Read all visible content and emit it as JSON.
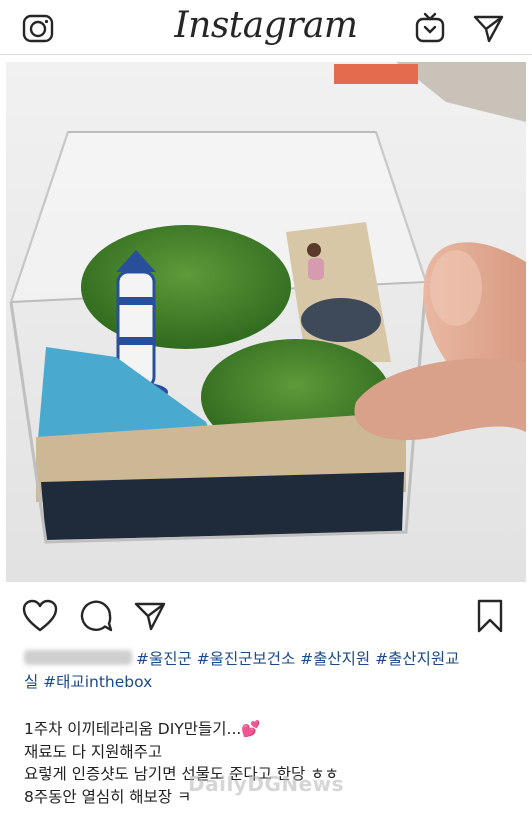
{
  "header": {
    "app_title": "Instagram",
    "icons": [
      "camera-icon",
      "igtv-icon",
      "direct-message-icon"
    ]
  },
  "post": {
    "actions": [
      "like-heart-icon",
      "comment-icon",
      "share-icon",
      "save-bookmark-icon"
    ],
    "caption_tags_line1": "#울진군 #울진군보건소 #출산지원 #출산지원교",
    "caption_tags_line2": "실 #태교inthebox",
    "body": {
      "line1": "1주차 이끼테라리움 DIY만들기...",
      "line1_emoji": "💕",
      "line2": "재료도 다 지원해주고",
      "line3": "요렇게 인증샷도 남기면 선물도 준다고 한당 ㅎㅎ",
      "line4": "8주동안 열심히 해보장 ㅋ"
    }
  },
  "watermark": "DailyDGNews",
  "colors": {
    "hashtag": "#1d4a88",
    "text": "#262626",
    "divider": "#dbdbdb"
  }
}
